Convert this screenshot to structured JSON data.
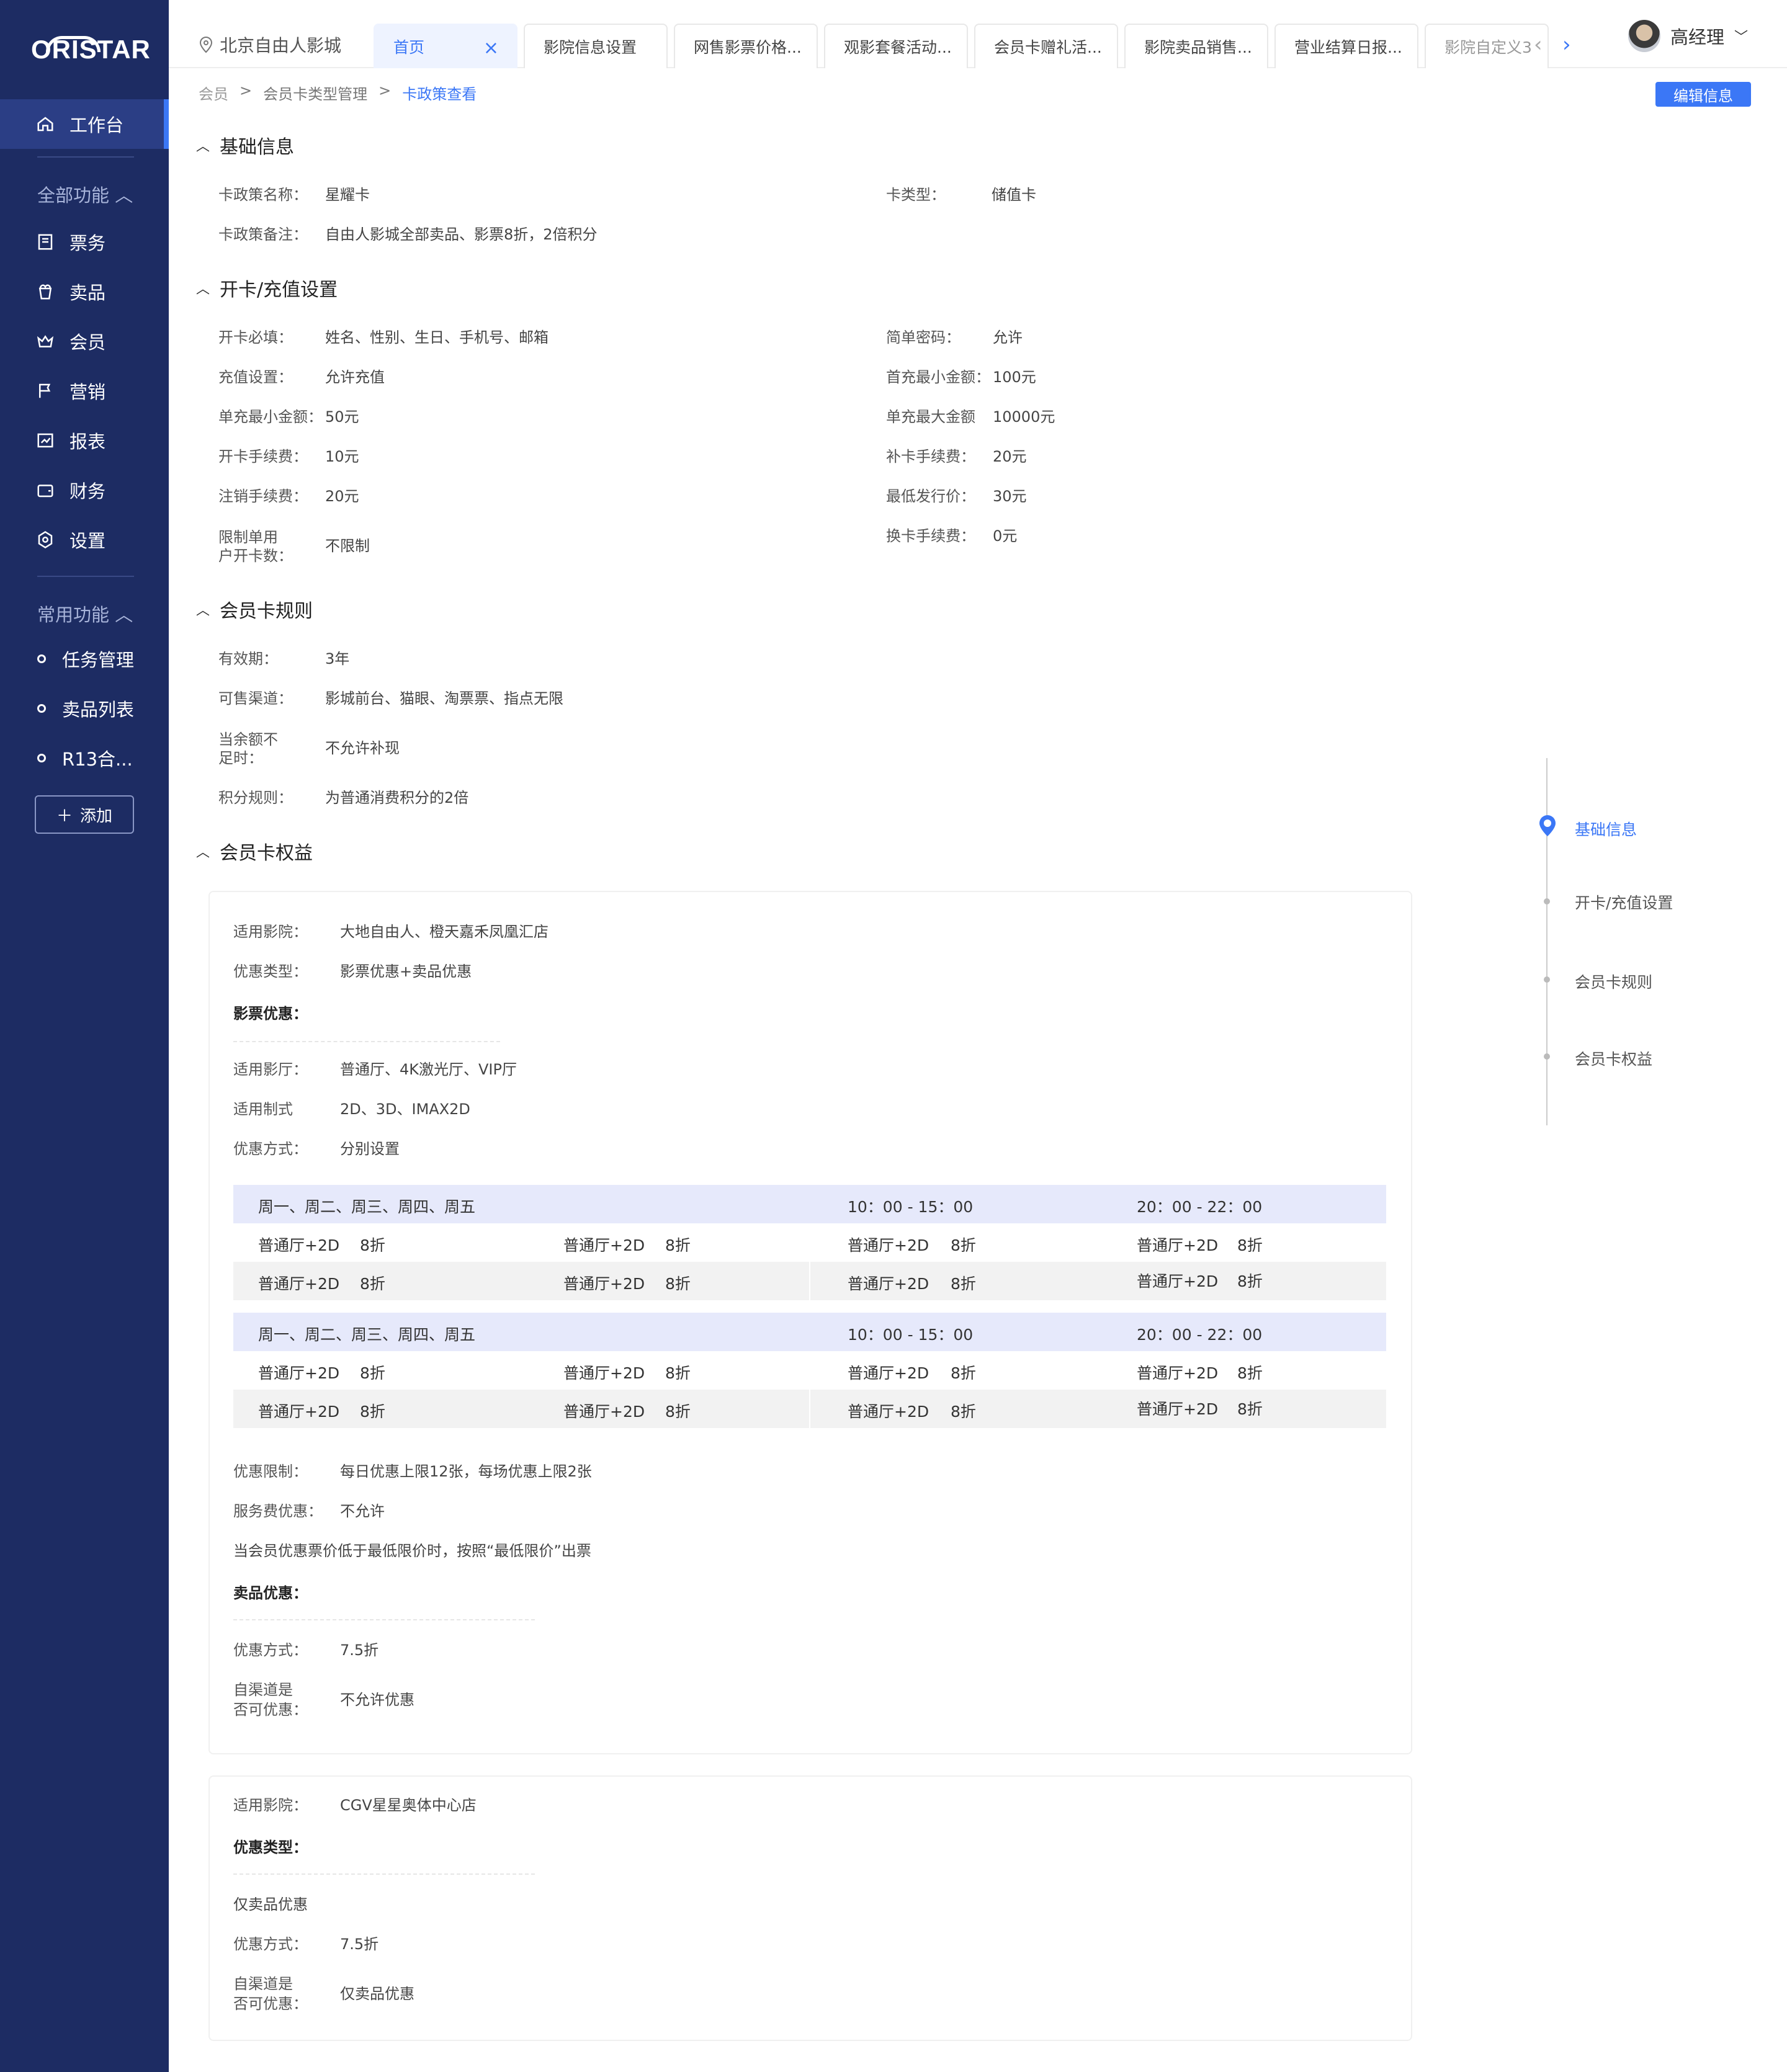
{
  "app": {
    "logo": "ORISTAR",
    "location": "北京自由人影城",
    "user_name": "高经理"
  },
  "sidebar": {
    "workbench": "工作台",
    "all_functions": "全部功能",
    "items": [
      {
        "label": "票务",
        "icon": "ticket-icon"
      },
      {
        "label": "卖品",
        "icon": "popcorn-icon"
      },
      {
        "label": "会员",
        "icon": "crown-icon"
      },
      {
        "label": "营销",
        "icon": "flag-icon"
      },
      {
        "label": "报表",
        "icon": "report-icon"
      },
      {
        "label": "财务",
        "icon": "wallet-icon"
      },
      {
        "label": "设置",
        "icon": "gear-icon"
      }
    ],
    "common_functions": "常用功能",
    "common_items": [
      {
        "label": "任务管理"
      },
      {
        "label": "卖品列表"
      },
      {
        "label": "R13合..."
      }
    ],
    "add_label": "添加"
  },
  "tabs": [
    {
      "label": "首页",
      "active": true
    },
    {
      "label": "影院信息设置"
    },
    {
      "label": "网售影票价格..."
    },
    {
      "label": "观影套餐活动..."
    },
    {
      "label": "会员卡赠礼活..."
    },
    {
      "label": "影院卖品销售..."
    },
    {
      "label": "营业结算日报..."
    },
    {
      "label": "影院自定义3"
    }
  ],
  "breadcrumb": [
    "会员",
    "会员卡类型管理",
    "卡政策查看"
  ],
  "breadcrumb_sep": ">",
  "edit_button": "编辑信息",
  "sections": {
    "basic": {
      "title": "基础信息",
      "name_label": "卡政策名称：",
      "name_value": "星耀卡",
      "type_label": "卡类型：",
      "type_value": "储值卡",
      "remark_label": "卡政策备注：",
      "remark_value": "自由人影城全部卖品、影票8折，2倍积分"
    },
    "open": {
      "title": "开卡/充值设置",
      "fields": [
        {
          "label": "开卡必填：",
          "value": "姓名、性别、生日、手机号、邮箱"
        },
        {
          "label": "简单密码：",
          "value": "允许"
        },
        {
          "label": "充值设置：",
          "value": "允许充值"
        },
        {
          "label": "首充最小金额：",
          "value": "100元"
        },
        {
          "label": "单充最小金额：",
          "value": "50元"
        },
        {
          "label": "单充最大金额",
          "value": "10000元"
        },
        {
          "label": "开卡手续费：",
          "value": "10元"
        },
        {
          "label": "补卡手续费：",
          "value": "20元"
        },
        {
          "label": "注销手续费：",
          "value": "20元"
        },
        {
          "label": "最低发行价：",
          "value": "30元"
        },
        {
          "label1": "限制单用",
          "label2": "户开卡数：",
          "value": "不限制"
        },
        {
          "label": "换卡手续费：",
          "value": "0元"
        }
      ]
    },
    "rules": {
      "title": "会员卡规则",
      "validity_label": "有效期：",
      "validity_value": "3年",
      "channel_label": "可售渠道：",
      "channel_value": "影城前台、猫眼、淘票票、指点无限",
      "balance_label1": "当余额不",
      "balance_label2": "足时：",
      "balance_value": "不允许补现",
      "points_label": "积分规则：",
      "points_value": "为普通消费积分的2倍"
    },
    "benefits": {
      "title": "会员卡权益",
      "card1": {
        "cinema_label": "适用影院：",
        "cinema_value": "大地自由人、橙天嘉禾凤凰汇店",
        "type_label": "优惠类型：",
        "type_value": "影票优惠+卖品优惠",
        "ticket_title": "影票优惠：",
        "hall_label": "适用影厅：",
        "hall_value": "普通厅、4K激光厅、VIP厅",
        "format_label": "适用制式",
        "format_value": "2D、3D、IMAX2D",
        "method_label": "优惠方式：",
        "method_value": "分别设置",
        "schedule": [
          {
            "days": "周一、周二、周三、周四、周五",
            "time1": "10：00 - 15：00",
            "time2": "20：00 - 22：00",
            "rows": [
              [
                "普通厅+2D",
                "8折",
                "普通厅+2D",
                "8折",
                "普通厅+2D",
                "8折",
                "普通厅+2D",
                "8折"
              ],
              [
                "普通厅+2D",
                "8折",
                "普通厅+2D",
                "8折",
                "普通厅+2D",
                "8折",
                "普通厅+2D",
                "8折"
              ]
            ]
          },
          {
            "days": "周一、周二、周三、周四、周五",
            "time1": "10：00 - 15：00",
            "time2": "20：00 - 22：00",
            "rows": [
              [
                "普通厅+2D",
                "8折",
                "普通厅+2D",
                "8折",
                "普通厅+2D",
                "8折",
                "普通厅+2D",
                "8折"
              ],
              [
                "普通厅+2D",
                "8折",
                "普通厅+2D",
                "8折",
                "普通厅+2D",
                "8折",
                "普通厅+2D",
                "8折"
              ]
            ]
          }
        ],
        "limit_label": "优惠限制：",
        "limit_value": "每日优惠上限12张，每场优惠上限2张",
        "service_label": "服务费优惠：",
        "service_value": "不允许",
        "lowest_note": "当会员优惠票价低于最低限价时，按照“最低限价”出票",
        "concession_title": "卖品优惠：",
        "c_method_label": "优惠方式：",
        "c_method_value": "7.5折",
        "c_channel_label1": "自渠道是",
        "c_channel_label2": "否可优惠：",
        "c_channel_value": "不允许优惠"
      },
      "card2": {
        "cinema_label": "适用影院：",
        "cinema_value": "CGV星星奥体中心店",
        "type_title": "优惠类型：",
        "only": "仅卖品优惠",
        "method_label": "优惠方式：",
        "method_value": "7.5折",
        "channel_label1": "自渠道是",
        "channel_label2": "否可优惠：",
        "channel_value": "仅卖品优惠"
      }
    }
  },
  "anchor_nav": [
    {
      "label": "基础信息",
      "active": true
    },
    {
      "label": "开卡/充值设置"
    },
    {
      "label": "会员卡规则"
    },
    {
      "label": "会员卡权益"
    }
  ],
  "colors": {
    "sidebar": "#1d2c63",
    "accent": "#3b77f6",
    "table_header": "#e6e9fb",
    "table_gray": "#f2f2f2"
  }
}
